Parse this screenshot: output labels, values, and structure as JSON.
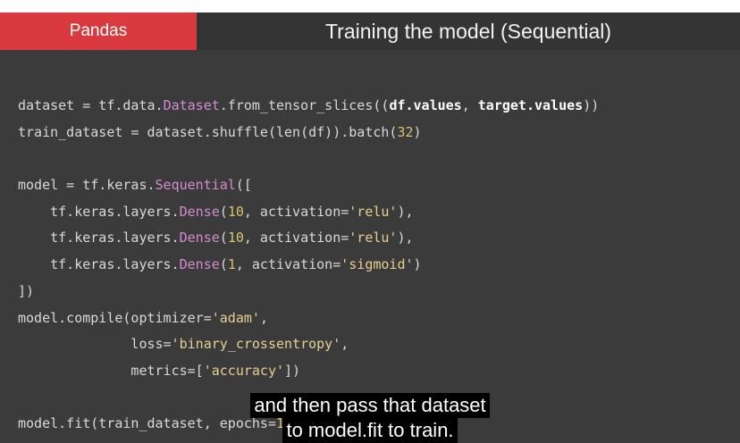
{
  "header": {
    "badge": "Pandas",
    "title": "Training the model (Sequential)"
  },
  "code": {
    "l1_a": "dataset = tf.data.",
    "l1_b": "Dataset",
    "l1_c": ".from_tensor_slices((",
    "l1_d": "df.values",
    "l1_e": ", ",
    "l1_f": "target.values",
    "l1_g": "))",
    "l2_a": "train_dataset = dataset.shuffle(len(df)).batch(",
    "l2_b": "32",
    "l2_c": ")",
    "l4_a": "model = tf.keras.",
    "l4_b": "Sequential",
    "l4_c": "([",
    "l5_a": "    tf.keras.layers.",
    "l5_b": "Dense",
    "l5_c": "(",
    "l5_d": "10",
    "l5_e": ", activation=",
    "l5_f": "'relu'",
    "l5_g": "),",
    "l6_a": "    tf.keras.layers.",
    "l6_b": "Dense",
    "l6_c": "(",
    "l6_d": "10",
    "l6_e": ", activation=",
    "l6_f": "'relu'",
    "l6_g": "),",
    "l7_a": "    tf.keras.layers.",
    "l7_b": "Dense",
    "l7_c": "(",
    "l7_d": "1",
    "l7_e": ", activation=",
    "l7_f": "'sigmoid'",
    "l7_g": ")",
    "l8": "])",
    "l9_a": "model.compile(optimizer=",
    "l9_b": "'adam'",
    "l9_c": ",",
    "l10_a": "              loss=",
    "l10_b": "'binary_crossentropy'",
    "l10_c": ",",
    "l11_a": "              metrics=[",
    "l11_b": "'accuracy'",
    "l11_c": "])",
    "l13_a": "model.fit(train_dataset, epochs=",
    "l13_b": "15",
    "l13_c": ")"
  },
  "captions": {
    "line1": "and then pass that dataset",
    "line2": "to model.fit to train."
  }
}
